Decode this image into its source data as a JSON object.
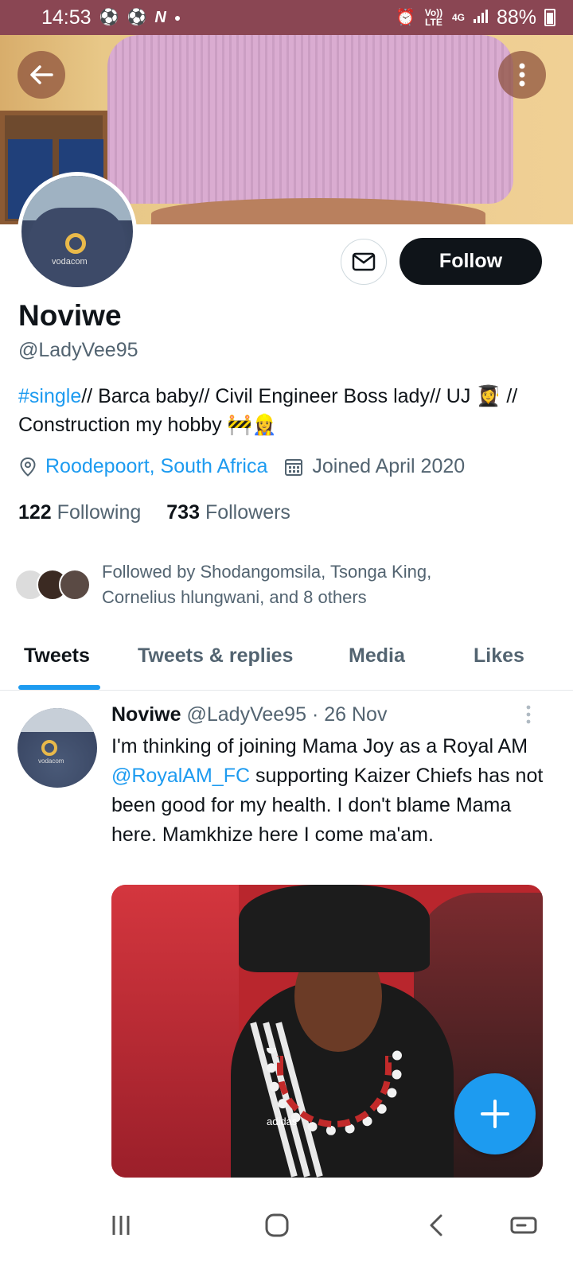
{
  "status_bar": {
    "time": "14:53",
    "left_icons": [
      "soccer-ball-icon",
      "soccer-ball-icon",
      "n-icon",
      "dot-icon"
    ],
    "right_icons": [
      "alarm-icon",
      "volte-icon",
      "4g-icon",
      "signal-icon"
    ],
    "volte_label": "Vo)) LTE",
    "network_label": "4G",
    "battery": "88%"
  },
  "header": {
    "back_icon": "arrow-left-icon",
    "more_icon": "more-vertical-icon"
  },
  "profile": {
    "name": "Noviwe",
    "handle": "@LadyVee95",
    "bio_hashtag": "#single",
    "bio_rest": "// Barca baby// Civil Engineer Boss lady// UJ 👩‍🎓 // Construction my hobby 🚧👷‍♀️",
    "location": "Roodepoort, South Africa",
    "joined": "Joined April 2020",
    "following_count": "122",
    "following_label": "Following",
    "followers_count": "733",
    "followers_label": "Followers",
    "followed_by": "Followed by Shodangomsila, Tsonga King, Cornelius hlungwani, and 8 others",
    "message_icon": "envelope-icon",
    "follow_button": "Follow",
    "avatar_brand": "vodacom"
  },
  "tabs": [
    {
      "label": "Tweets",
      "active": true
    },
    {
      "label": "Tweets & replies",
      "active": false
    },
    {
      "label": "Media",
      "active": false
    },
    {
      "label": "Likes",
      "active": false
    }
  ],
  "tweet": {
    "author": "Noviwe",
    "handle": "@LadyVee95",
    "separator": "·",
    "date": "26 Nov",
    "more_icon": "more-vertical-icon",
    "text_before": "I'm thinking of joining Mama Joy as a Royal AM ",
    "mention": "@RoyalAM_FC",
    "text_after": " supporting Kaizer Chiefs has not been good for my health. I don't blame Mama here. Mamkhize here I come ma'am.",
    "image_brand": "adidas",
    "avatar_brand": "vodacom"
  },
  "fab": {
    "icon": "plus-icon"
  },
  "colors": {
    "status_bar": "#8a4653",
    "accent": "#1d9bf0",
    "text": "#0f1419",
    "secondary": "#536471"
  },
  "nav": {
    "icons": [
      "recent-apps-icon",
      "home-icon",
      "back-icon",
      "rotate-icon"
    ]
  }
}
